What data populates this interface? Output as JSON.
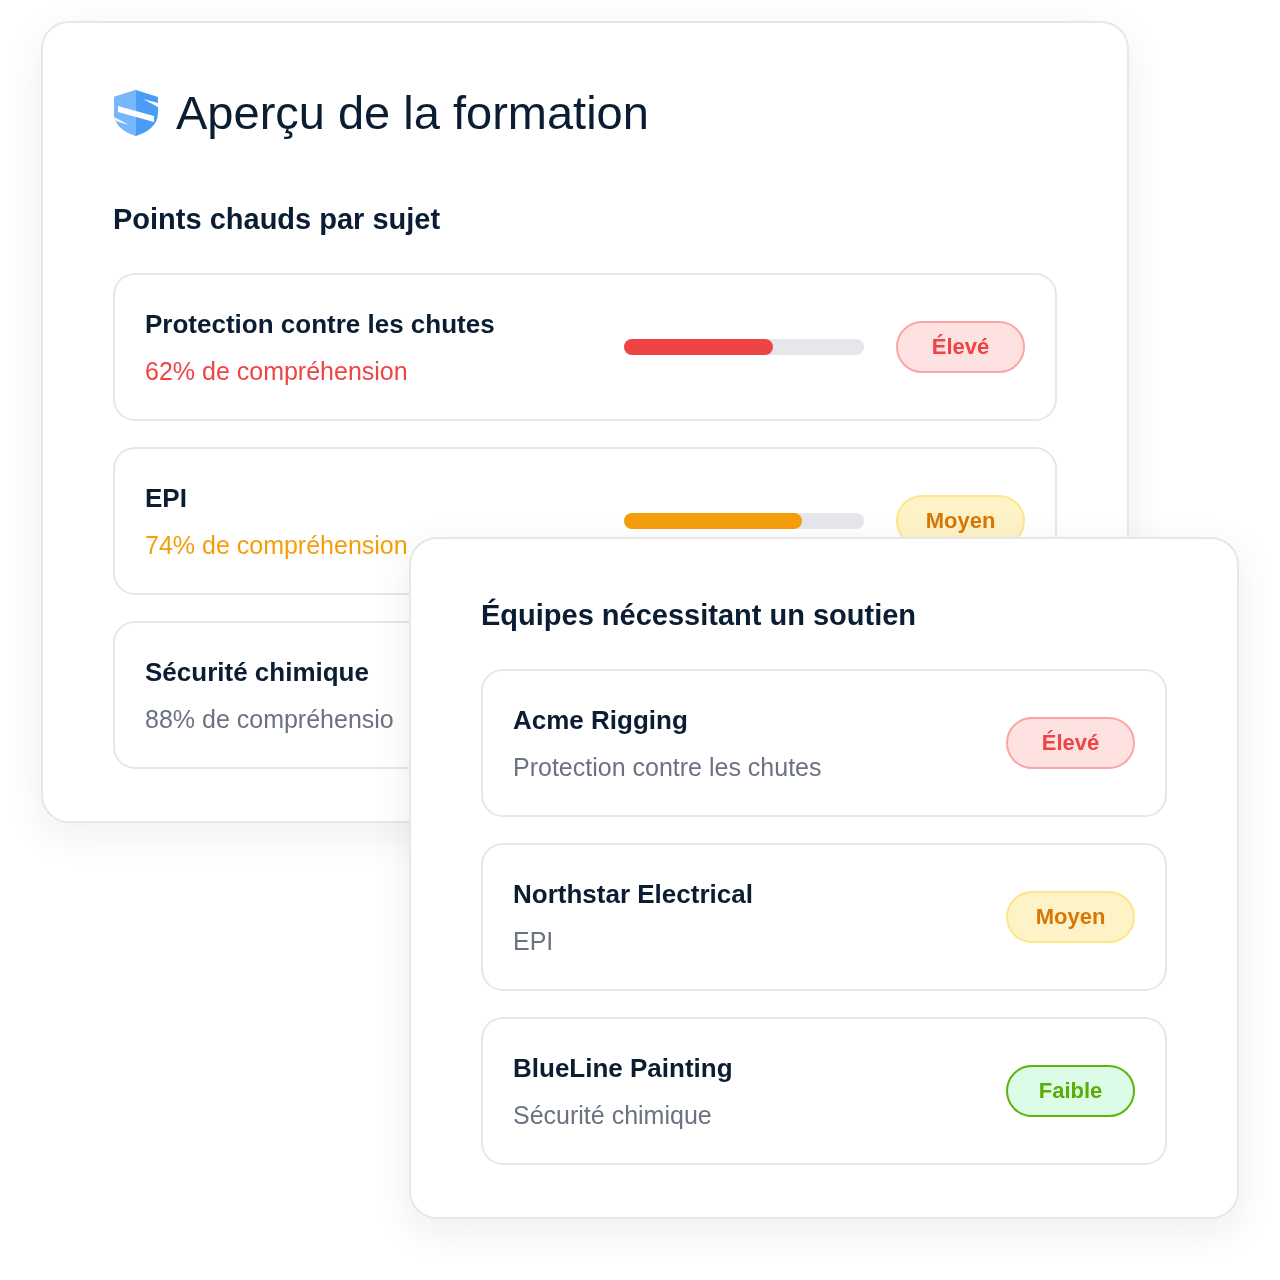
{
  "overview": {
    "title": "Aperçu de la formation",
    "section_title": "Points chauds par sujet",
    "topics": [
      {
        "title": "Protection contre les chutes",
        "comprehension": "62% de compréhension",
        "kind": "high",
        "level": 0.62,
        "badge": "Élevé"
      },
      {
        "title": "EPI",
        "comprehension": "74% de compréhension",
        "kind": "medium",
        "level": 0.74,
        "badge": "Moyen"
      },
      {
        "title": "Sécurité chimique",
        "comprehension": "88% de compréhensio",
        "kind": "low"
      }
    ]
  },
  "support": {
    "title": "Équipes nécessitant un soutien",
    "teams": [
      {
        "name": "Acme Rigging",
        "topic": "Protection contre les chutes",
        "kind": "high",
        "badge": "Élevé"
      },
      {
        "name": "Northstar Electrical",
        "topic": "EPI",
        "kind": "medium",
        "badge": "Moyen"
      },
      {
        "name": "BlueLine Painting",
        "topic": "Sécurité chimique",
        "kind": "low",
        "badge": "Faible"
      }
    ]
  }
}
